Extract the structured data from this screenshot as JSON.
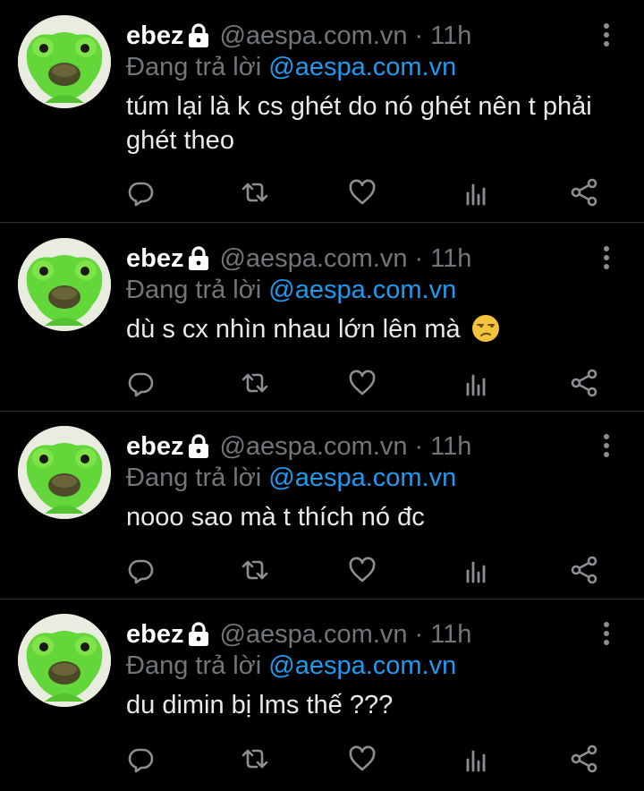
{
  "tweets": [
    {
      "name": "ebez",
      "handle": "@aespa.com.vn",
      "separator": "·",
      "time": "11h",
      "reply_prefix": "Đang trả lời",
      "reply_to": "@aespa.com.vn",
      "text": "túm lại là k cs ghét do nó ghét nên t phải ghét theo"
    },
    {
      "name": "ebez",
      "handle": "@aespa.com.vn",
      "separator": "·",
      "time": "11h",
      "reply_prefix": "Đang trả lời",
      "reply_to": "@aespa.com.vn",
      "text": "dù s cx nhìn nhau lớn lên mà",
      "emoji": "unamused-face-icon"
    },
    {
      "name": "ebez",
      "handle": "@aespa.com.vn",
      "separator": "·",
      "time": "11h",
      "reply_prefix": "Đang trả lời",
      "reply_to": "@aespa.com.vn",
      "text": "nooo sao mà t thích nó đc"
    },
    {
      "name": "ebez",
      "handle": "@aespa.com.vn",
      "separator": "·",
      "time": "11h",
      "reply_prefix": "Đang trả lời",
      "reply_to": "@aespa.com.vn",
      "text": "du dimin bị lms thế ???"
    }
  ],
  "icons": {
    "lock": "lock-icon",
    "more": "more-vertical-icon",
    "reply": "reply-icon",
    "retweet": "retweet-icon",
    "like": "heart-icon",
    "views": "views-chart-icon",
    "share": "share-icon"
  },
  "colors": {
    "background": "#000000",
    "text": "#e7e9ea",
    "secondary": "#71767b",
    "accent": "#1d9bf0",
    "divider": "#2f3336"
  }
}
